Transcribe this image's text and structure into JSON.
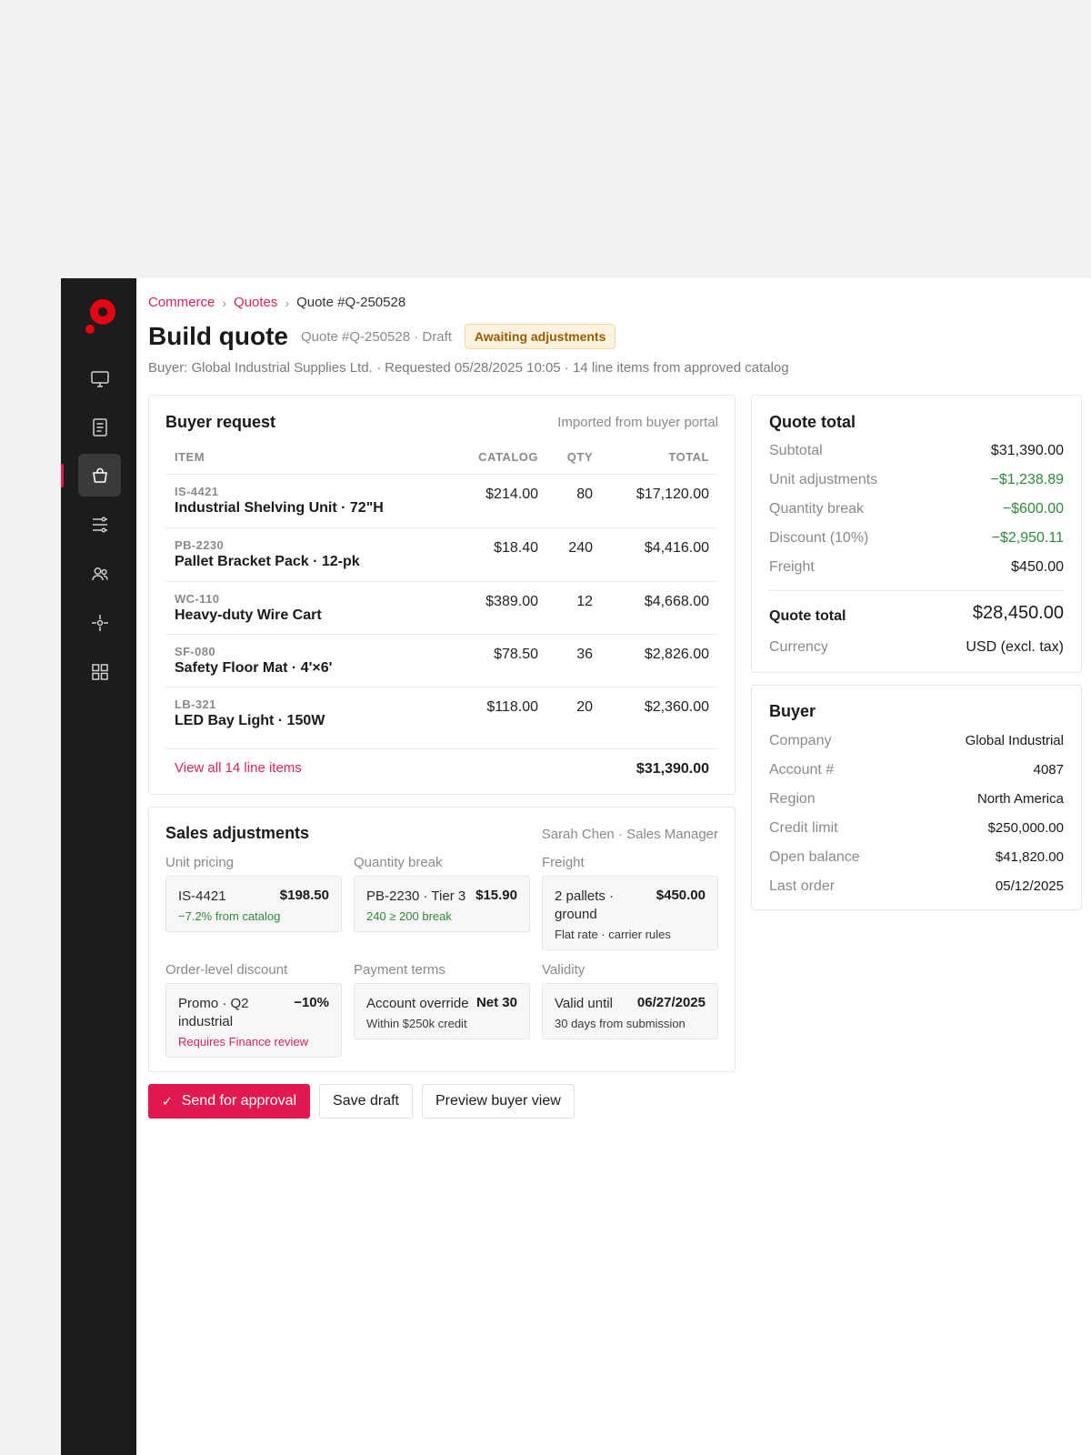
{
  "nav": {
    "items": [
      {
        "icon": "monitor-icon"
      },
      {
        "icon": "document-icon"
      },
      {
        "icon": "shopping-bag-icon",
        "active": true
      },
      {
        "icon": "sliders-icon"
      },
      {
        "icon": "users-icon"
      },
      {
        "icon": "target-icon"
      },
      {
        "icon": "grid-icon"
      }
    ]
  },
  "breadcrumb": {
    "items": [
      "Commerce",
      "Quotes"
    ],
    "current": "Quote #Q-250528"
  },
  "header": {
    "title": "Build quote",
    "meta": "Quote #Q-250528 · Draft",
    "badge": "Awaiting adjustments",
    "subline": "Buyer: Global Industrial Supplies Ltd. · Requested 05/28/2025 10:05 · 14 line items from approved catalog"
  },
  "buyer_request": {
    "title": "Buyer request",
    "note": "Imported from buyer portal",
    "columns": {
      "item": "ITEM",
      "catalog": "CATALOG",
      "qty": "QTY",
      "total": "TOTAL"
    },
    "rows": [
      {
        "sku": "IS-4421",
        "name": "Industrial Shelving Unit · 72\"H",
        "catalog": "$214.00",
        "qty": "80",
        "total": "$17,120.00"
      },
      {
        "sku": "PB-2230",
        "name": "Pallet Bracket Pack · 12-pk",
        "catalog": "$18.40",
        "qty": "240",
        "total": "$4,416.00"
      },
      {
        "sku": "WC-110",
        "name": "Heavy-duty Wire Cart",
        "catalog": "$389.00",
        "qty": "12",
        "total": "$4,668.00"
      },
      {
        "sku": "SF-080",
        "name": "Safety Floor Mat · 4'×6'",
        "catalog": "$78.50",
        "qty": "36",
        "total": "$2,826.00"
      },
      {
        "sku": "LB-321",
        "name": "LED Bay Light · 150W",
        "catalog": "$118.00",
        "qty": "20",
        "total": "$2,360.00"
      }
    ],
    "view_all": "View all 14 line items",
    "sum": "$31,390.00"
  },
  "sales_adjustments": {
    "title": "Sales adjustments",
    "note": "Sarah Chen · Sales Manager",
    "unit_pricing": {
      "label": "Unit pricing",
      "key": "IS-4421",
      "value": "$198.50",
      "sub": "−7.2% from catalog"
    },
    "quantity_break": {
      "label": "Quantity break",
      "key": "PB-2230 · Tier 3",
      "value": "$15.90",
      "sub": "240 ≥ 200 break"
    },
    "freight": {
      "label": "Freight",
      "key": "2 pallets · ground",
      "value": "$450.00",
      "sub": "Flat rate · carrier rules"
    },
    "discount": {
      "label": "Order-level discount",
      "key": "Promo · Q2 industrial",
      "value": "−10%",
      "sub": "Requires Finance review"
    },
    "payment_terms": {
      "label": "Payment terms",
      "key": "Account override",
      "value": "Net 30",
      "sub": "Within $250k credit"
    },
    "validity": {
      "label": "Validity",
      "key": "Valid until",
      "value": "06/27/2025",
      "sub": "30 days from submission"
    }
  },
  "actions": {
    "send": "Send for approval",
    "save": "Save draft",
    "preview": "Preview buyer view"
  },
  "quote_total": {
    "title": "Quote total",
    "lines": [
      {
        "label": "Subtotal",
        "value": "$31,390.00"
      },
      {
        "label": "Unit adjustments",
        "value": "−$1,238.89"
      },
      {
        "label": "Quantity break",
        "value": "−$600.00"
      },
      {
        "label": "Discount (10%)",
        "value": "−$2,950.11"
      },
      {
        "label": "Freight",
        "value": "$450.00"
      }
    ],
    "total_label": "Quote total",
    "total_value": "$28,450.00",
    "currency_label": "Currency",
    "currency_value": "USD (excl. tax)"
  },
  "buyer": {
    "title": "Buyer",
    "lines": [
      {
        "label": "Company",
        "value": "Global Industrial"
      },
      {
        "label": "Account #",
        "value": "4087"
      },
      {
        "label": "Region",
        "value": "North America"
      },
      {
        "label": "Credit limit",
        "value": "$250,000.00"
      },
      {
        "label": "Open balance",
        "value": "$41,820.00"
      },
      {
        "label": "Last order",
        "value": "05/12/2025"
      }
    ]
  },
  "colors": {
    "accent": "#e2194f",
    "positive": "#2f8a3c",
    "sidebar": "#1c1c1c",
    "badge_bg": "#fdf3df",
    "badge_text": "#9a5a00"
  }
}
